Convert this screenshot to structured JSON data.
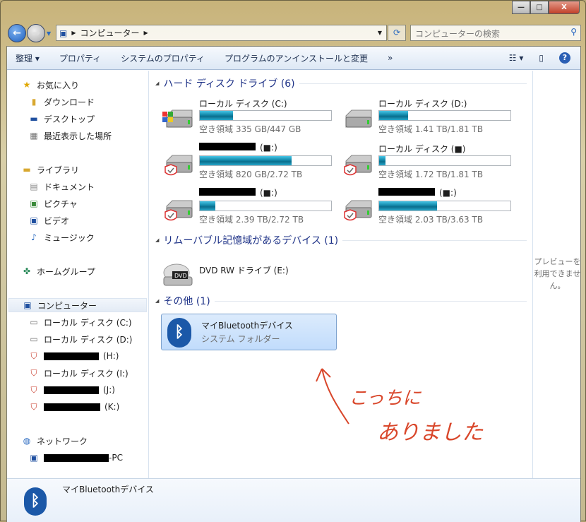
{
  "window": {
    "title_buttons": {
      "minimize": "—",
      "maximize": "□",
      "close": "X"
    }
  },
  "address": {
    "crumb": "コンピューター",
    "search_placeholder": "コンピューターの検索"
  },
  "toolbar": {
    "organize": "整理 ▾",
    "properties": "プロパティ",
    "system_properties": "システムのプロパティ",
    "uninstall": "プログラムのアンインストールと変更",
    "more": "»"
  },
  "sidebar": {
    "favorites": "お気に入り",
    "downloads": "ダウンロード",
    "desktop": "デスクトップ",
    "recent": "最近表示した場所",
    "libraries": "ライブラリ",
    "documents": "ドキュメント",
    "pictures": "ピクチャ",
    "videos": "ビデオ",
    "music": "ミュージック",
    "homegroup": "ホームグループ",
    "computer": "コンピューター",
    "drives": [
      "ローカル ディスク (C:)",
      "ローカル ディスク (D:)",
      "(H:)",
      "ローカル ディスク (I:)",
      "(J:)",
      "(K:)"
    ],
    "network": "ネットワーク",
    "pc": "-PC"
  },
  "groups": {
    "hdd": "ハード ディスク ドライブ (6)",
    "removable": "リムーバブル記憶域があるデバイス (1)",
    "other": "その他 (1)"
  },
  "drives": [
    {
      "name": "ローカル ディスク (C:)",
      "free": "空き領域 335 GB/447 GB",
      "used_fraction": 0.25,
      "redacted": false
    },
    {
      "name": "ローカル ディスク (D:)",
      "free": "空き領域 1.41 TB/1.81 TB",
      "used_fraction": 0.22,
      "redacted": false
    },
    {
      "name": "(■:)",
      "free": "空き領域 820 GB/2.72 TB",
      "used_fraction": 0.7,
      "redacted": true
    },
    {
      "name": "ローカル ディスク (■)",
      "free": "空き領域 1.72 TB/1.81 TB",
      "used_fraction": 0.05,
      "redacted": false
    },
    {
      "name": "(■:)",
      "free": "空き領域 2.39 TB/2.72 TB",
      "used_fraction": 0.12,
      "redacted": true
    },
    {
      "name": "(■:)",
      "free": "空き領域 2.03 TB/3.63 TB",
      "used_fraction": 0.44,
      "redacted": true
    }
  ],
  "dvd": {
    "name": "DVD RW ドライブ (E:)",
    "badge": "DVD"
  },
  "bluetooth": {
    "name": "マイBluetoothデバイス",
    "type": "システム フォルダー"
  },
  "preview": "プレビューを利用できません。",
  "details": {
    "name": "マイBluetoothデバイス"
  },
  "annotation": {
    "line1": "こっちに",
    "line2": "ありました",
    "color": "#d9472b"
  }
}
